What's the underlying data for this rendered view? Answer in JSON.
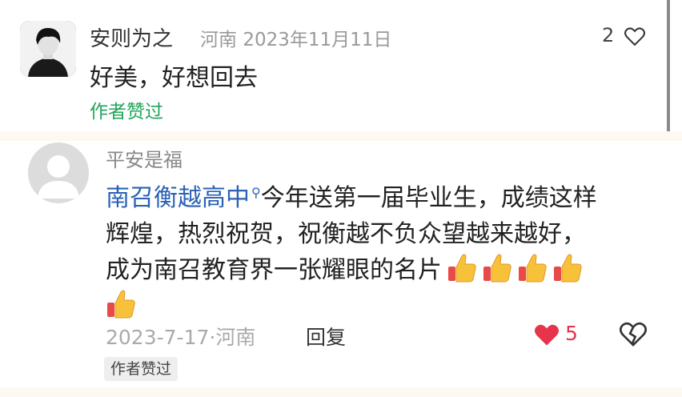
{
  "comment1": {
    "username": "安则为之",
    "location": "河南",
    "date": "2023年11月11日",
    "like_count": "2",
    "text": "好美，好想回去",
    "author_liked": "作者赞过"
  },
  "comment2": {
    "username": "平安是福",
    "link_text": "南召衡越高中",
    "text_line1": "今年送第一届毕业生，成绩这样",
    "text_line2": "辉煌，热烈祝贺，祝衡越不负众望越来越好，",
    "text_line3": "成为南召教育界一张耀眼的名片",
    "emoji_count": 5,
    "emoji_name": "thumbs-up",
    "date_location": "2023-7-17·河南",
    "reply_label": "回复",
    "like_count": "5",
    "author_liked": "作者赞过"
  },
  "colors": {
    "accent_green": "#1fa65a",
    "link_blue": "#2b62b5",
    "heart_red": "#e5344b"
  }
}
